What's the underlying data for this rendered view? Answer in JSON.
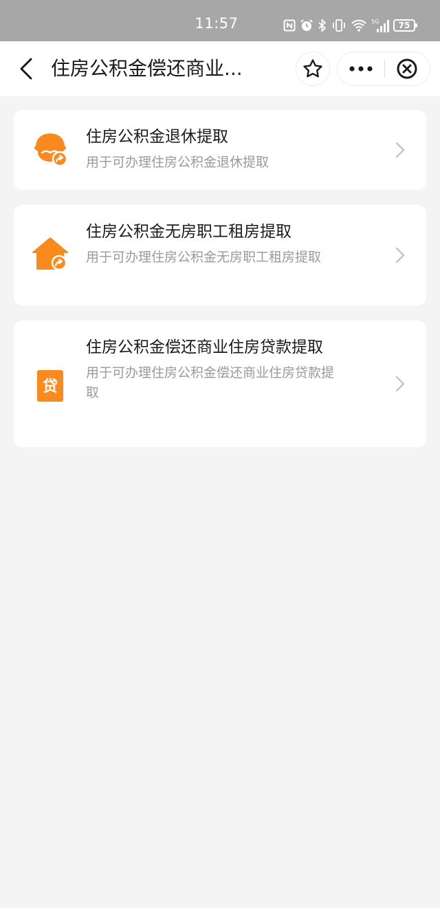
{
  "status_bar": {
    "time": "11:57",
    "battery": "75",
    "icons": [
      "nfc-icon",
      "alarm-icon",
      "bluetooth-icon",
      "vibrate-icon",
      "wifi-icon",
      "signal-5g-icon",
      "battery-icon"
    ]
  },
  "nav": {
    "title": "住房公积金偿还商业...",
    "icons": [
      "back-icon",
      "star-icon",
      "more-icon",
      "close-circle-icon"
    ]
  },
  "items": [
    {
      "title": "住房公积金退休提取",
      "desc": "用于可办理住房公积金退休提取",
      "icon": "retiree-icon"
    },
    {
      "title": "住房公积金无房职工租房提取",
      "desc": "用于可办理住房公积金无房职工租房提取",
      "icon": "house-icon"
    },
    {
      "title": "住房公积金偿还商业住房贷款提取",
      "desc": "用于可办理住房公积金偿还商业住房贷款提取",
      "icon": "loan-icon",
      "icon_text": "贷"
    }
  ],
  "colors": {
    "accent": "#fa8a1e",
    "status_bar": "#a7a7a7",
    "background": "#f4f4f4"
  }
}
